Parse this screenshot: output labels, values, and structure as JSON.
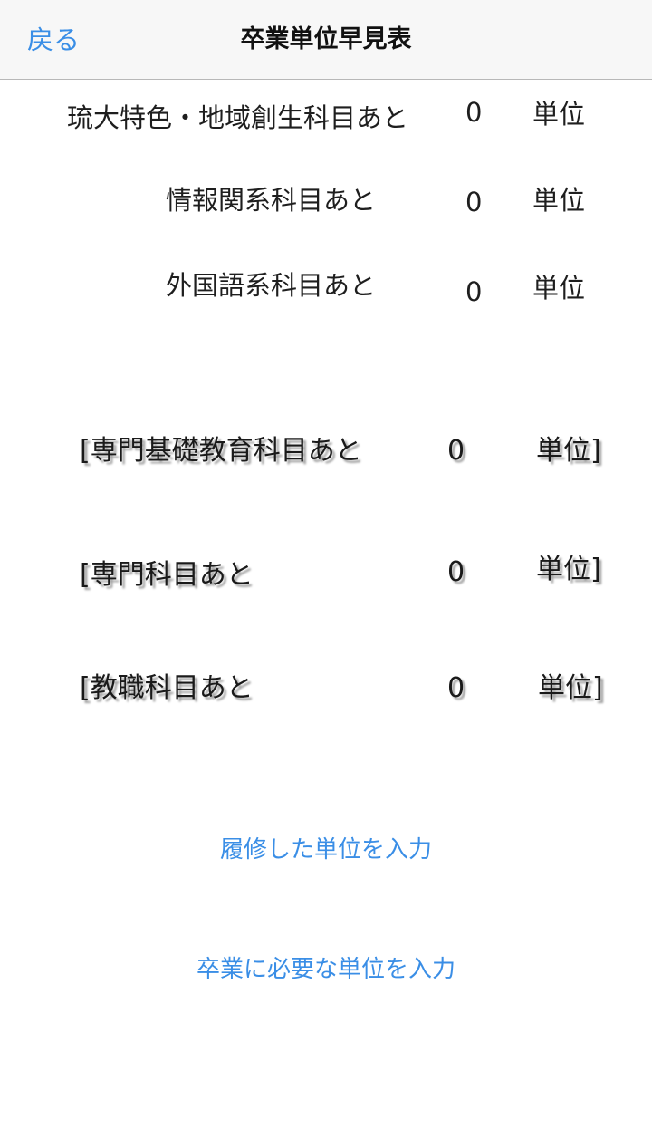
{
  "navbar": {
    "back_label": "戻る",
    "title": "卒業単位早見表"
  },
  "general_rows": [
    {
      "label": "琉大特色・地域創生科目あと",
      "value": "0",
      "unit": "単位"
    },
    {
      "label": "情報関系科目あと",
      "value": "0",
      "unit": "単位"
    },
    {
      "label": "外国語系科目あと",
      "value": "0",
      "unit": "単位"
    }
  ],
  "special_rows": [
    {
      "label": "[専門基礎教育科目あと",
      "value": "0",
      "unit": "単位]"
    },
    {
      "label": "[専門科目あと",
      "value": "0",
      "unit": "単位]"
    },
    {
      "label": "[教職科目あと",
      "value": "0",
      "unit": "単位]"
    }
  ],
  "actions": {
    "enter_completed": "履修した単位を入力",
    "enter_required": "卒業に必要な単位を入力"
  },
  "colors": {
    "accent": "#3a8ee6",
    "navbar_bg": "#f7f7f7",
    "text": "#1a1a1a"
  }
}
